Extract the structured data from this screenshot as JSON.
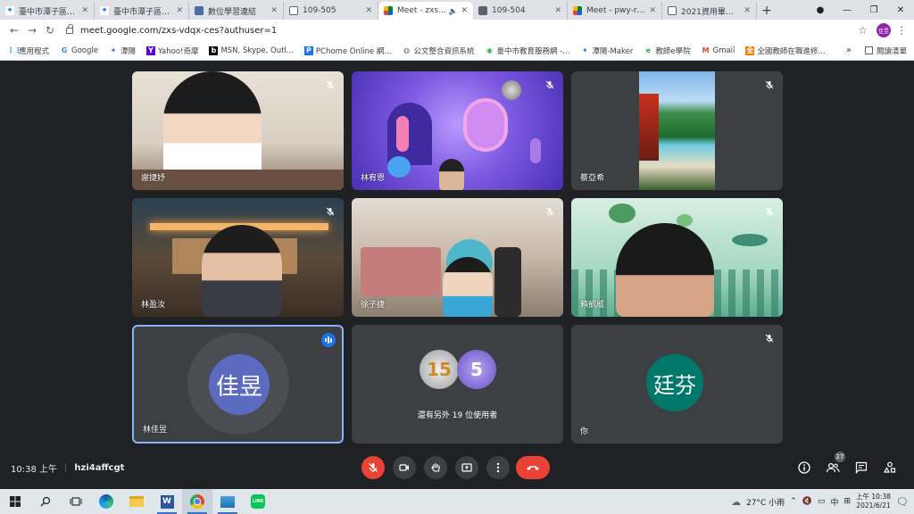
{
  "browser": {
    "tabs": [
      {
        "title": "臺中市潭子區潭陽",
        "favicon": "bird-favicon",
        "active": false
      },
      {
        "title": "臺中市潭子區潭陽",
        "favicon": "bird-favicon",
        "active": false
      },
      {
        "title": "數位學習連結",
        "favicon": "doc-favicon",
        "active": false
      },
      {
        "title": "109-505",
        "favicon": "page-favicon",
        "active": false
      },
      {
        "title": "Meet - zxs-vdqx",
        "favicon": "meet-favicon",
        "active": true
      },
      {
        "title": "109-504",
        "favicon": "image-favicon",
        "active": false
      },
      {
        "title": "Meet - pwy-rwia",
        "favicon": "meet-favicon",
        "active": false
      },
      {
        "title": "2021資用畢業祝",
        "favicon": "page-favicon",
        "active": false
      }
    ],
    "new_tab_label": "+",
    "address": "meet.google.com/zxs-vdqx-ces?authuser=1",
    "profile_initials": "佳昱",
    "bookmarks": [
      {
        "label": "應用程式",
        "icon": "apps-icon"
      },
      {
        "label": "Google",
        "icon": "google-icon"
      },
      {
        "label": "潭陽",
        "icon": "bird-icon"
      },
      {
        "label": "Yahoo!奇摩",
        "icon": "yahoo-icon"
      },
      {
        "label": "MSN, Skype, Outl...",
        "icon": "msn-icon"
      },
      {
        "label": "PChome Online 網...",
        "icon": "pchome-icon"
      },
      {
        "label": "公文整合資訊系統",
        "icon": "globe-icon"
      },
      {
        "label": "臺中市教育服務網 -...",
        "icon": "gov-icon"
      },
      {
        "label": "潭陽-Maker",
        "icon": "bird-icon"
      },
      {
        "label": "教師e學院",
        "icon": "e-icon"
      },
      {
        "label": "Gmail",
        "icon": "gmail-icon"
      },
      {
        "label": "全國教師在職進修...",
        "icon": "teacher-icon"
      }
    ],
    "bookmarks_more": "»",
    "reading_list": "閱讀清單"
  },
  "meet": {
    "participants": [
      {
        "name": "謝捷妤",
        "muted": true
      },
      {
        "name": "林宥恩",
        "muted": true
      },
      {
        "name": "蔡亞希",
        "muted": true
      },
      {
        "name": "林盈汝",
        "muted": true
      },
      {
        "name": "徐子捷",
        "muted": true
      },
      {
        "name": "賴凱威",
        "muted": true
      },
      {
        "name": "林佳昱",
        "avatar_text": "佳昱",
        "speaking": true
      },
      {
        "others_text": "還有另外 19 位使用者",
        "mini_left": "15",
        "mini_right": "5"
      },
      {
        "name": "你",
        "avatar_text": "廷芬",
        "muted": true
      }
    ],
    "clock": "10:38 上午",
    "meeting_code": "hzi4affcgt",
    "people_count": "27",
    "colors": {
      "accent": "#8ab4f8",
      "danger": "#ea4335",
      "avatar_blue": "#5c6bc0",
      "avatar_green": "#00796b"
    }
  },
  "taskbar": {
    "weather": "27°C 小雨",
    "ime": "中",
    "time": "上午 10:38",
    "date": "2021/6/21"
  }
}
